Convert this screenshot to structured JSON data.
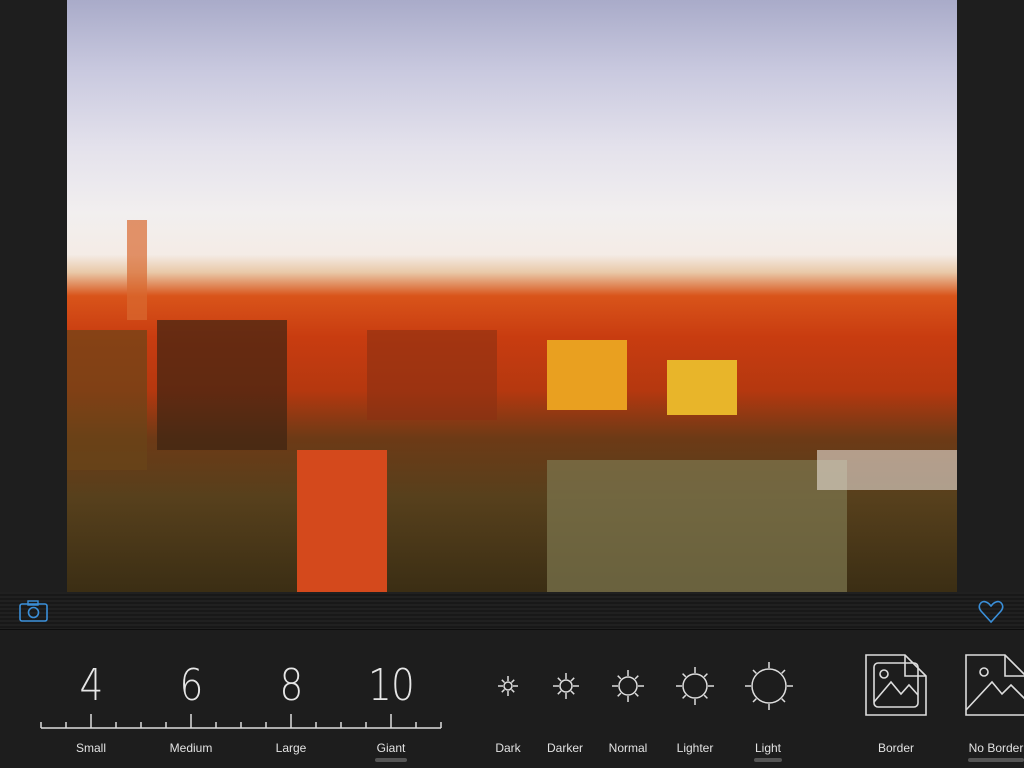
{
  "toolbar": {
    "camera_icon": "camera-icon",
    "favorite_icon": "heart-icon",
    "accent": "#3a8fd9"
  },
  "brush_size": {
    "numbers": [
      "4",
      "6",
      "8",
      "10"
    ],
    "labels": [
      "Small",
      "Medium",
      "Large",
      "Giant"
    ],
    "selected": "Giant"
  },
  "brightness": {
    "labels": [
      "Dark",
      "Darker",
      "Normal",
      "Lighter",
      "Light"
    ],
    "selected": "Light"
  },
  "border": {
    "labels": [
      "Border",
      "No Border"
    ],
    "selected": "No Border"
  }
}
